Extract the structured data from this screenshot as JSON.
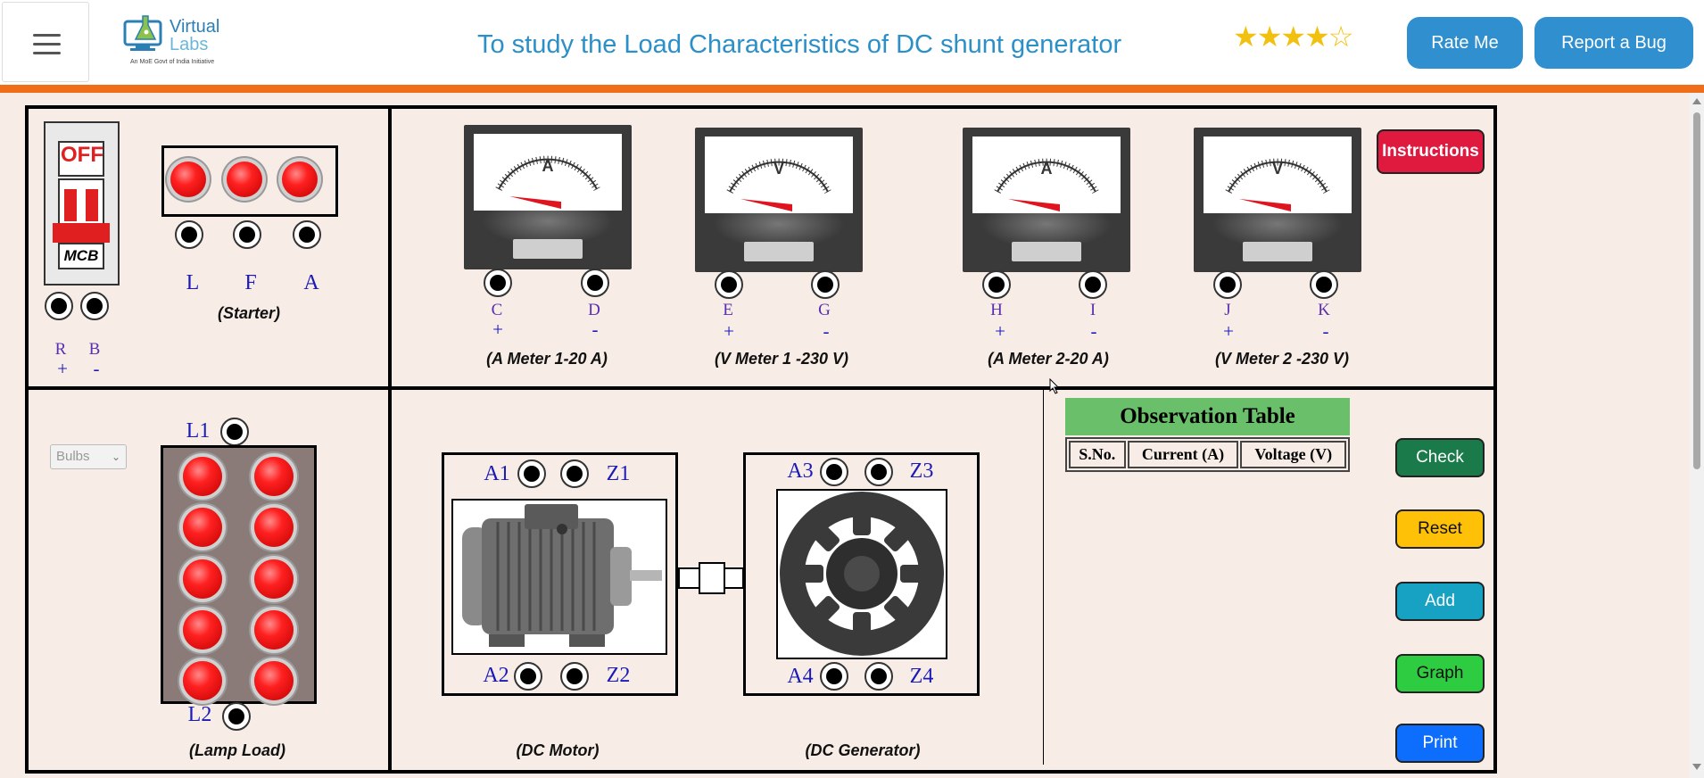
{
  "header": {
    "menu_icon": "hamburger-menu-icon",
    "logo": {
      "brand_line1": "Virtual",
      "brand_line2": "Labs",
      "tagline": "An MoE Govt of India Initiative"
    },
    "title": "To study the Load Characteristics of DC shunt generator",
    "rating": {
      "value": 4,
      "max": 5,
      "icon": "star-icon",
      "color": "#f2c10f"
    },
    "rate_label": "Rate Me",
    "bug_label": "Report a Bug",
    "accent_color": "#2f8fcf",
    "bar_color": "#f06e1a"
  },
  "supply": {
    "mcb": {
      "state": "OFF",
      "label": "MCB"
    },
    "terminals": [
      {
        "name": "R",
        "sign": "+"
      },
      {
        "name": "B",
        "sign": "-"
      }
    ]
  },
  "starter": {
    "caption": "(Starter)",
    "terminals": [
      "L",
      "F",
      "A"
    ]
  },
  "meters": [
    {
      "symbol": "A",
      "caption": "(A Meter 1-20 A)",
      "terminals": [
        {
          "name": "C",
          "sign": "+"
        },
        {
          "name": "D",
          "sign": "-"
        }
      ]
    },
    {
      "symbol": "V",
      "caption": "(V Meter 1 -230 V)",
      "terminals": [
        {
          "name": "E",
          "sign": "+"
        },
        {
          "name": "G",
          "sign": "-"
        }
      ]
    },
    {
      "symbol": "A",
      "caption": "(A Meter 2-20 A)",
      "terminals": [
        {
          "name": "H",
          "sign": "+"
        },
        {
          "name": "I",
          "sign": "-"
        }
      ]
    },
    {
      "symbol": "V",
      "caption": "(V Meter 2 -230 V)",
      "terminals": [
        {
          "name": "J",
          "sign": "+"
        },
        {
          "name": "K",
          "sign": "-"
        }
      ]
    }
  ],
  "instructions_label": "Instructions",
  "lamp_load": {
    "caption": "(Lamp Load)",
    "select_value": "Bulbs",
    "top_terminal": "L1",
    "bottom_terminal": "L2"
  },
  "motor": {
    "caption": "(DC Motor)",
    "terminals": {
      "top_left": "A1",
      "top_right": "Z1",
      "bottom_left": "A2",
      "bottom_right": "Z2"
    }
  },
  "generator": {
    "caption": "(DC Generator)",
    "terminals": {
      "top_left": "A3",
      "top_right": "Z3",
      "bottom_left": "A4",
      "bottom_right": "Z4"
    }
  },
  "observation_table": {
    "title": "Observation Table",
    "columns": [
      "S.No.",
      "Current (A)",
      "Voltage (V)"
    ],
    "rows": []
  },
  "actions": {
    "check": {
      "label": "Check",
      "color": "#1a7a4a"
    },
    "reset": {
      "label": "Reset",
      "color": "#ffc107"
    },
    "add": {
      "label": "Add",
      "color": "#17a2c4"
    },
    "graph": {
      "label": "Graph",
      "color": "#2ecc40"
    },
    "print": {
      "label": "Print",
      "color": "#0d6efd"
    }
  }
}
